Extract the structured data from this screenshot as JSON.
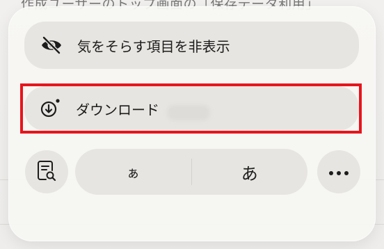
{
  "background": {
    "text": "作成ユーザーのトップ画面の「保存データ利用」"
  },
  "menu": {
    "hide_distracting_label": "気をそらす項目を非表示",
    "download_label": "ダウンロード",
    "kana_small_label": "ぁ",
    "kana_large_label": "あ"
  },
  "colors": {
    "highlight": "#e8141c",
    "button_bg": "#e7e5e1"
  },
  "icons": {
    "hide": "eye-slash-icon",
    "download": "download-circle-icon",
    "lookup": "document-search-icon",
    "more": "ellipsis-icon"
  }
}
